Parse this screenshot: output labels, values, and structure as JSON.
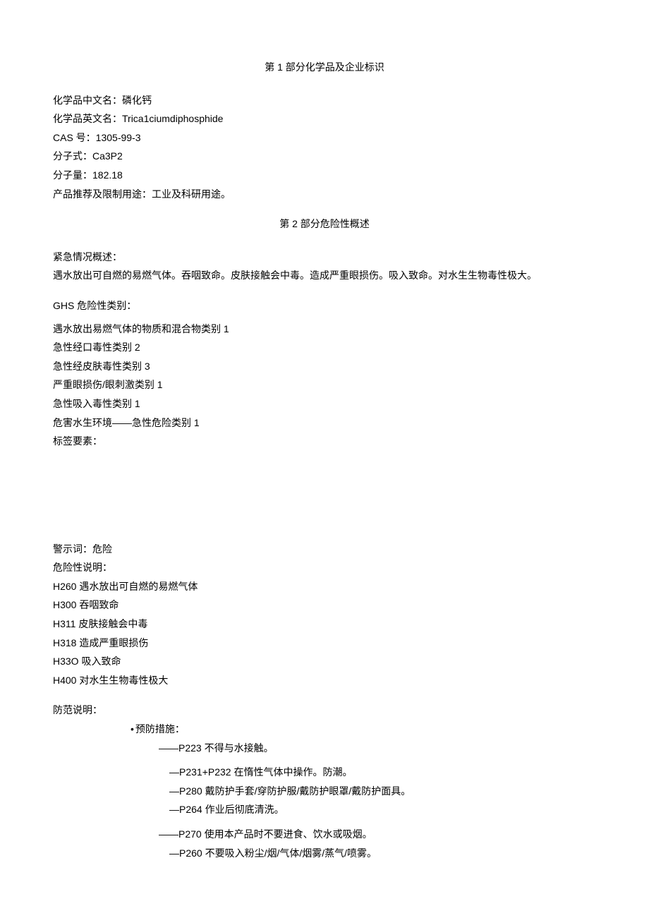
{
  "section1": {
    "title": "第 1 部分化学品及企业标识",
    "lines": [
      "化学品中文名：磷化钙",
      "化学品英文名：Trica1ciumdiphosphide",
      "CAS 号：1305-99-3",
      "分子式：Ca3P2",
      "分子量：182.18",
      "产品推荐及限制用途：工业及科研用途。"
    ]
  },
  "section2": {
    "title": "第 2 部分危险性概述",
    "emergency_label": "紧急情况概述：",
    "emergency_text": "遇水放出可自燃的易燃气体。吞咽致命。皮肤接触会中毒。造成严重眼损伤。吸入致命。对水生生物毒性极大。",
    "ghs_label": "GHS 危险性类别：",
    "ghs_items": [
      "遇水放出易燃气体的物质和混合物类别 1",
      "急性经口毒性类别 2",
      "急性经皮肤毒性类别 3",
      "严重眼损伤/眼刺激类别 1",
      "急性吸入毒性类别 1",
      "危害水生环境——急性危险类别 1"
    ],
    "label_elements": "标签要素：",
    "signal_word": "警示词：危险",
    "hazard_label": "危险性说明：",
    "hazard_statements": [
      "H260 遇水放出可自燃的易燃气体",
      "H300 吞咽致命",
      "H311 皮肤接触会中毒",
      "H318 造成严重眼损伤",
      "H33O 吸入致命",
      "H400 对水生生物毒性极大"
    ],
    "precaution_label": "防范说明：",
    "prevention_label": "预防措施：",
    "prevention_items": [
      "——P223 不得与水接触。",
      "—P231+P232 在惰性气体中操作。防潮。",
      "—P280 戴防护手套/穿防护服/戴防护眼罩/戴防护面具。",
      "—P264 作业后彻底清洗。",
      "——P270 使用本产品时不要进食、饮水或吸烟。",
      "—P260 不要吸入粉尘/烟/气体/烟雾/蒸气/喷雾。"
    ]
  }
}
